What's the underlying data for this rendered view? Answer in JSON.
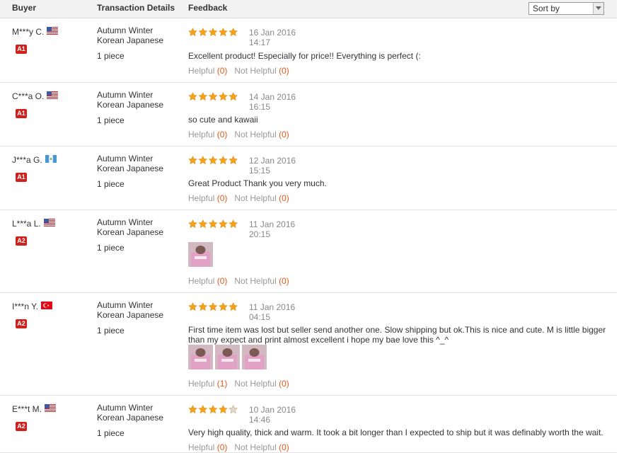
{
  "header": {
    "buyer_label": "Buyer",
    "transaction_label": "Transaction Details",
    "feedback_label": "Feedback",
    "sort_label": "Sort by"
  },
  "helpful_label": "Helpful",
  "not_helpful_label": "Not Helpful",
  "star_color": "#f4a21a",
  "badge_color": "#d0201b",
  "reviews": [
    {
      "buyer": "M***y C.",
      "flag": "us-flag-icon",
      "badge": "A1",
      "product": "Autumn Winter Korean Japanese Brand Sweatshirt",
      "qty": "1 piece",
      "rating": 5,
      "date": "16 Jan 2016",
      "time": "14:17",
      "comment": "Excellent product! Especially for price!! Everything is perfect (:",
      "helpful": "(0)",
      "not_helpful": "(0)"
    },
    {
      "buyer": "C***a O.",
      "flag": "us-flag-icon",
      "badge": "A1",
      "product": "Autumn Winter Korean Japanese Brand Sweatshirt",
      "qty": "1 piece",
      "rating": 5,
      "date": "14 Jan 2016",
      "time": "16:15",
      "comment": "so cute and kawaii",
      "helpful": "(0)",
      "not_helpful": "(0)"
    },
    {
      "buyer": "J***a G.",
      "flag": "guatemala-flag-icon",
      "badge": "A1",
      "product": "Autumn Winter Korean Japanese Brand Sweatshirt",
      "qty": "1 piece",
      "rating": 5,
      "date": "12 Jan 2016",
      "time": "15:15",
      "comment": "Great Product Thank you very much.",
      "helpful": "(0)",
      "not_helpful": "(0)"
    },
    {
      "buyer": "L***a L.",
      "flag": "us-flag-icon",
      "badge": "A2",
      "product": "Autumn Winter Korean Japanese Brand Sweatshirt",
      "qty": "1 piece",
      "rating": 5,
      "date": "11 Jan 2016",
      "time": "20:15",
      "comment": "",
      "photos": [
        "review-photo"
      ],
      "helpful": "(0)",
      "not_helpful": "(0)"
    },
    {
      "buyer": "I***n Y.",
      "flag": "turkey-flag-icon",
      "badge": "A2",
      "product": "Autumn Winter Korean Japanese Brand Sweatshirt",
      "qty": "1 piece",
      "rating": 5,
      "date": "11 Jan 2016",
      "time": "04:15",
      "comment": "First time item was lost but seller send another one. Slow shipping but ok.This is nice and cute. M is little bigger than my expect and print almost excellent i hope my bae love this ^_^",
      "photos": [
        "review-photo",
        "review-photo",
        "review-photo"
      ],
      "helpful": "(1)",
      "not_helpful": "(0)"
    },
    {
      "buyer": "E***t M.",
      "flag": "us-flag-icon",
      "badge": "A2",
      "product": "Autumn Winter Korean Japanese Brand Sweatshirt",
      "qty": "1 piece",
      "rating": 4,
      "date": "10 Jan 2016",
      "time": "14:46",
      "comment": "Very high quality, thick and warm. It took a bit longer than I expected to ship but it was definably worth the wait.",
      "helpful": "(0)",
      "not_helpful": "(0)"
    }
  ]
}
